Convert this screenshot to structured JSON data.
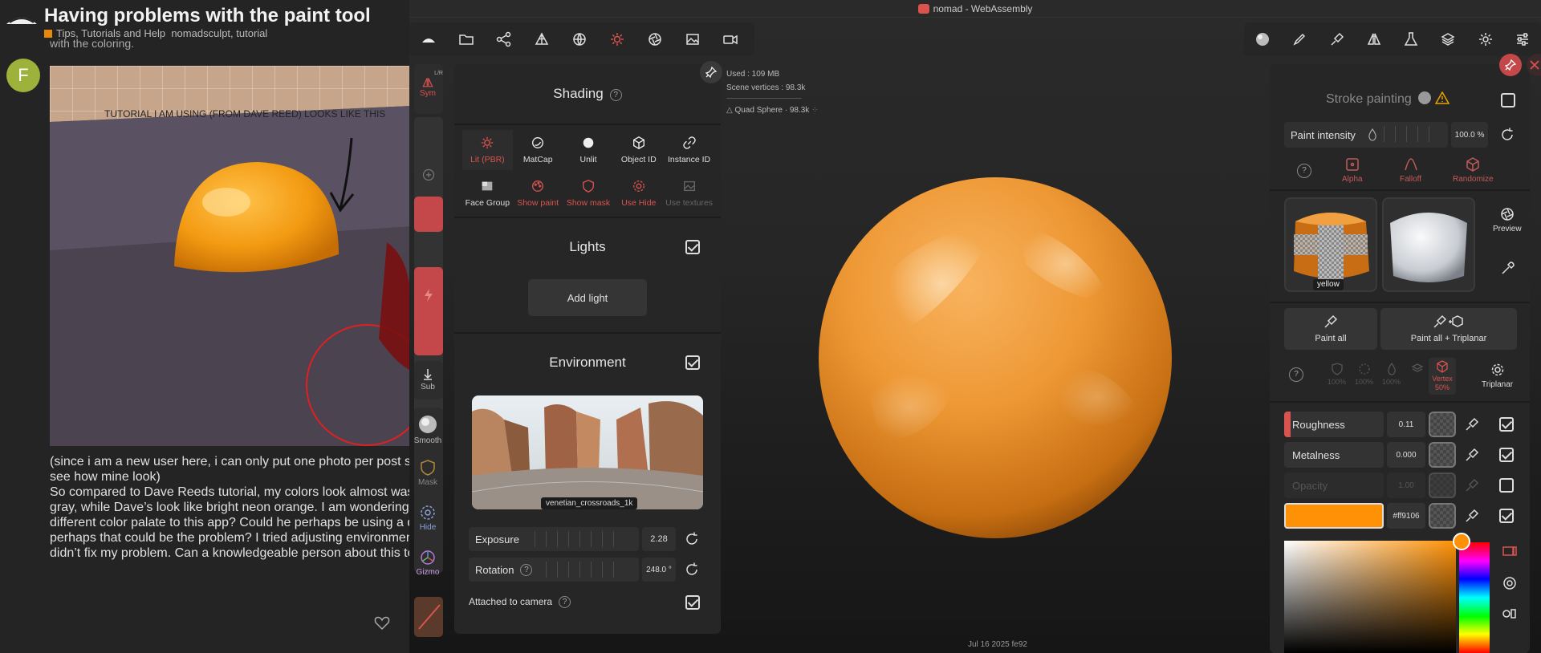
{
  "forum": {
    "topic_title": "Having problems with the paint tool",
    "category": "Tips, Tutorials and Help",
    "tags": "nomadsculpt, tutorial",
    "avatar_letter": "F",
    "cut_line": "with the coloring.",
    "photo_caption": "TUTORIAL I AM USING (FROM DAVE REED) LOOKS LIKE THIS",
    "post_lines": [
      "(since i am a new user here, i can only put one photo per post so c",
      "see how mine look)",
      "So compared to Dave Reeds tutorial, my colors look almost washe",
      "gray, while Dave’s look like bright neon orange. I am wondering is i",
      "different color palate to this app? Could he perhaps be using a diffe",
      "perhaps that could be the problem? I tried adjusting environment e",
      "didn’t fix my problem. Can a knowledgeable person about this topic"
    ]
  },
  "window": {
    "title": "nomad - WebAssembly"
  },
  "toolstrip": {
    "sym_top": "L/R",
    "sym_label": "Sym",
    "sub_label": "Sub",
    "smooth_label": "Smooth",
    "mask_label": "Mask",
    "hide_label": "Hide",
    "gizmo_label": "Gizmo"
  },
  "shading": {
    "title": "Shading",
    "modes": [
      {
        "label": "Lit (PBR)",
        "icon": "sun-icon"
      },
      {
        "label": "MatCap",
        "icon": "matcap-icon"
      },
      {
        "label": "Unlit",
        "icon": "circle-icon"
      },
      {
        "label": "Object ID",
        "icon": "cube-icon"
      },
      {
        "label": "Instance ID",
        "icon": "link-icon"
      }
    ],
    "options": [
      {
        "label": "Face Group",
        "icon": "facegroup-icon"
      },
      {
        "label": "Show paint",
        "icon": "palette-icon"
      },
      {
        "label": "Show mask",
        "icon": "shield-icon"
      },
      {
        "label": "Use Hide",
        "icon": "hide-icon"
      },
      {
        "label": "Use textures",
        "icon": "image-icon"
      }
    ],
    "lights_title": "Lights",
    "add_light": "Add light",
    "environment_title": "Environment",
    "env_name": "venetian_crossroads_1k",
    "exposure_label": "Exposure",
    "exposure_value": "2.28",
    "rotation_label": "Rotation",
    "rotation_value": "248.0 °",
    "attached_label": "Attached to camera"
  },
  "viewport": {
    "used": "Used : 109 MB",
    "scene_vertices": "Scene vertices : 98.3k",
    "object": "Quad Sphere · 98.3k",
    "datestamp": "Jul 16 2025 fe92"
  },
  "stroke": {
    "title": "Stroke painting",
    "intensity_label": "Paint intensity",
    "intensity_value": "100.0 %",
    "alpha": "Alpha",
    "falloff": "Falloff",
    "randomize": "Randomize",
    "material_name": "yellow",
    "preview": "Preview",
    "paint_all": "Paint all",
    "paint_all_triplanar": "Paint all + Triplanar",
    "channel_pcts": [
      "100%",
      "100%",
      "100%"
    ],
    "vertex_label": "Vertex",
    "vertex_pct": "50%",
    "triplanar": "Triplanar",
    "roughness_label": "Roughness",
    "roughness_value": "0.11",
    "metalness_label": "Metalness",
    "metalness_value": "0.000",
    "opacity_label": "Opacity",
    "opacity_value": "1.00",
    "color_hex": "#ff9106"
  },
  "colors": {
    "accent": "#d9534f",
    "paint_orange": "#ff9106"
  }
}
